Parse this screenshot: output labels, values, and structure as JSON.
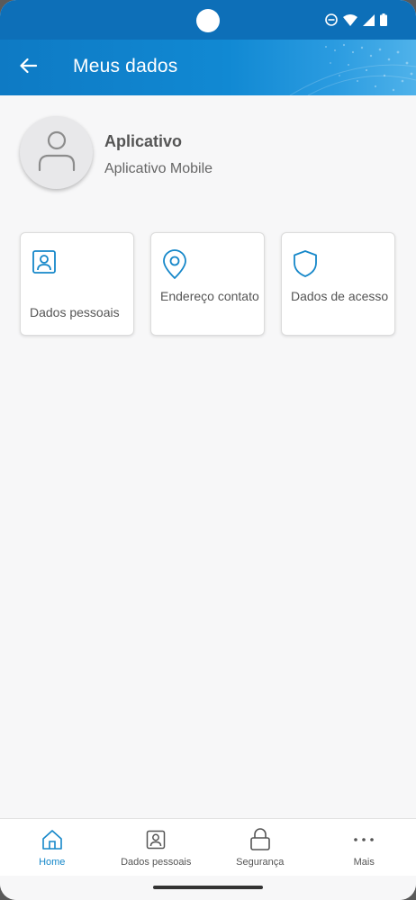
{
  "status_bar": {
    "icons": [
      "do-not-disturb-icon",
      "wifi-icon",
      "signal-icon",
      "battery-icon"
    ]
  },
  "app_bar": {
    "title": "Meus dados",
    "back_icon": "arrow-left-icon",
    "color": "#0e7ac4"
  },
  "profile": {
    "name": "Aplicativo",
    "subtitle": "Aplicativo Mobile",
    "avatar_icon": "user-icon"
  },
  "cards": [
    {
      "label": "Dados pessoais",
      "icon": "id-card-icon"
    },
    {
      "label": "Endereço contato",
      "icon": "map-pin-icon"
    },
    {
      "label": "Dados de acesso",
      "icon": "shield-icon"
    }
  ],
  "bottom_nav": {
    "items": [
      {
        "label": "Home",
        "icon": "home-icon",
        "active": true
      },
      {
        "label": "Dados pessoais",
        "icon": "id-card-icon",
        "active": false
      },
      {
        "label": "Segurança",
        "icon": "lock-icon",
        "active": false
      },
      {
        "label": "Mais",
        "icon": "more-dots-icon",
        "active": false
      }
    ],
    "active_color": "#1587c9"
  }
}
